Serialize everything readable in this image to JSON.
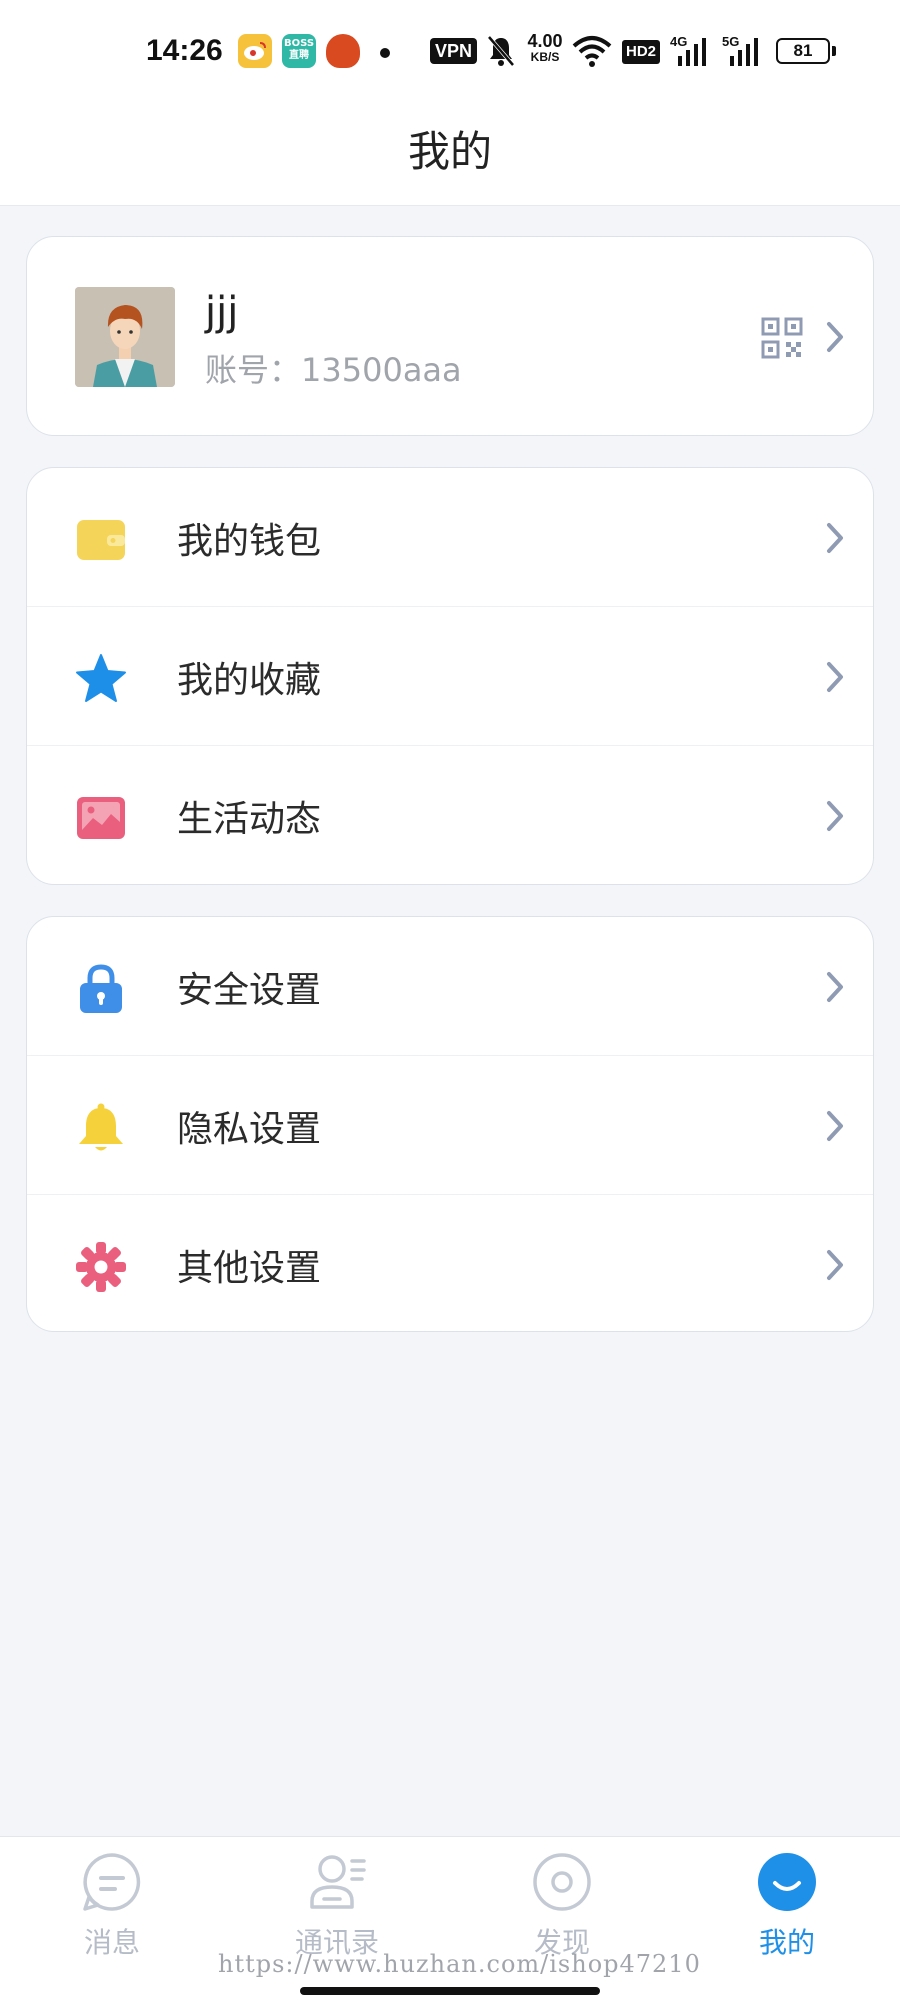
{
  "status_bar": {
    "time": "14:26",
    "vpn": "VPN",
    "speed_value": "4.00",
    "speed_unit": "KB/S",
    "hd": "HD2",
    "signal_1": "4G",
    "signal_2": "5G",
    "battery": "81",
    "notification_icons": [
      "weibo-icon",
      "boss-zhipin-icon",
      "app-icon"
    ]
  },
  "header": {
    "title": "我的"
  },
  "profile": {
    "name": "jjj",
    "account_label": "账号：",
    "account_value": "13500aaa"
  },
  "menu_group_1": [
    {
      "label": "我的钱包",
      "icon": "wallet-icon",
      "color": "#f5d45a"
    },
    {
      "label": "我的收藏",
      "icon": "star-icon",
      "color": "#1e8fe8"
    },
    {
      "label": "生活动态",
      "icon": "image-icon",
      "color": "#ea5f7e"
    }
  ],
  "menu_group_2": [
    {
      "label": "安全设置",
      "icon": "lock-icon",
      "color": "#3f8ee8"
    },
    {
      "label": "隐私设置",
      "icon": "bell-icon",
      "color": "#f5d23b"
    },
    {
      "label": "其他设置",
      "icon": "gear-icon",
      "color": "#ea5f7e"
    }
  ],
  "bottom_nav": [
    {
      "label": "消息",
      "icon": "message-icon",
      "active": false
    },
    {
      "label": "通讯录",
      "icon": "contacts-icon",
      "active": false
    },
    {
      "label": "发现",
      "icon": "discover-icon",
      "active": false
    },
    {
      "label": "我的",
      "icon": "me-icon",
      "active": true
    }
  ],
  "watermark": "https://www.huzhan.com/ishop47210",
  "colors": {
    "accent": "#1e90e8",
    "chevron": "#8f9bb3",
    "background": "#f3f5f9"
  }
}
